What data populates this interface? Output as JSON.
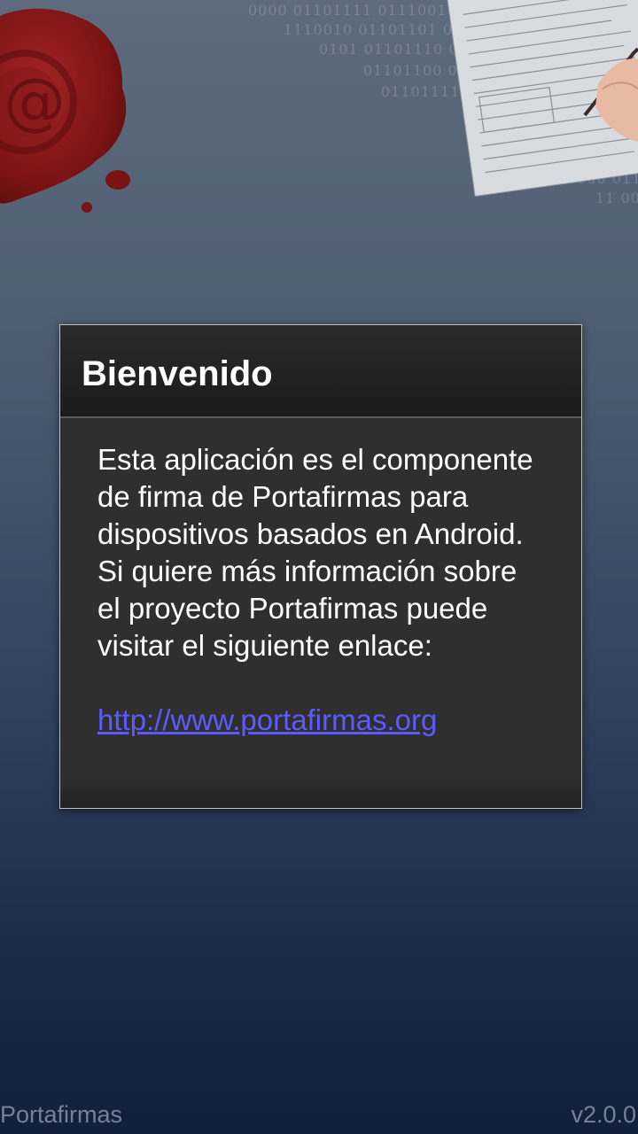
{
  "background": {
    "binary_lines": [
      "0000 01101111 01110010",
      "1110010 01101101 0",
      "0101 01101110 01",
      "01101100 01",
      "01101111 01",
      "0000 011",
      "11 00"
    ],
    "seal_icon": "wax-seal-at-sign-icon",
    "document_icon": "signing-document-illustration"
  },
  "dialog": {
    "title": "Bienvenido",
    "message": "Esta aplicación es el componente de firma de Portafirmas para dispositivos basados en Android. Si quiere más información sobre el proyecto Portafirmas puede visitar el siguiente enlace:",
    "link_text": "http://www.portafirmas.org"
  },
  "footer": {
    "app_name": "Portafirmas",
    "version": "v2.0.0"
  },
  "colors": {
    "link": "#5b5bff",
    "seal": "#8a1717",
    "dialog_bg": "#2f2f2f"
  }
}
